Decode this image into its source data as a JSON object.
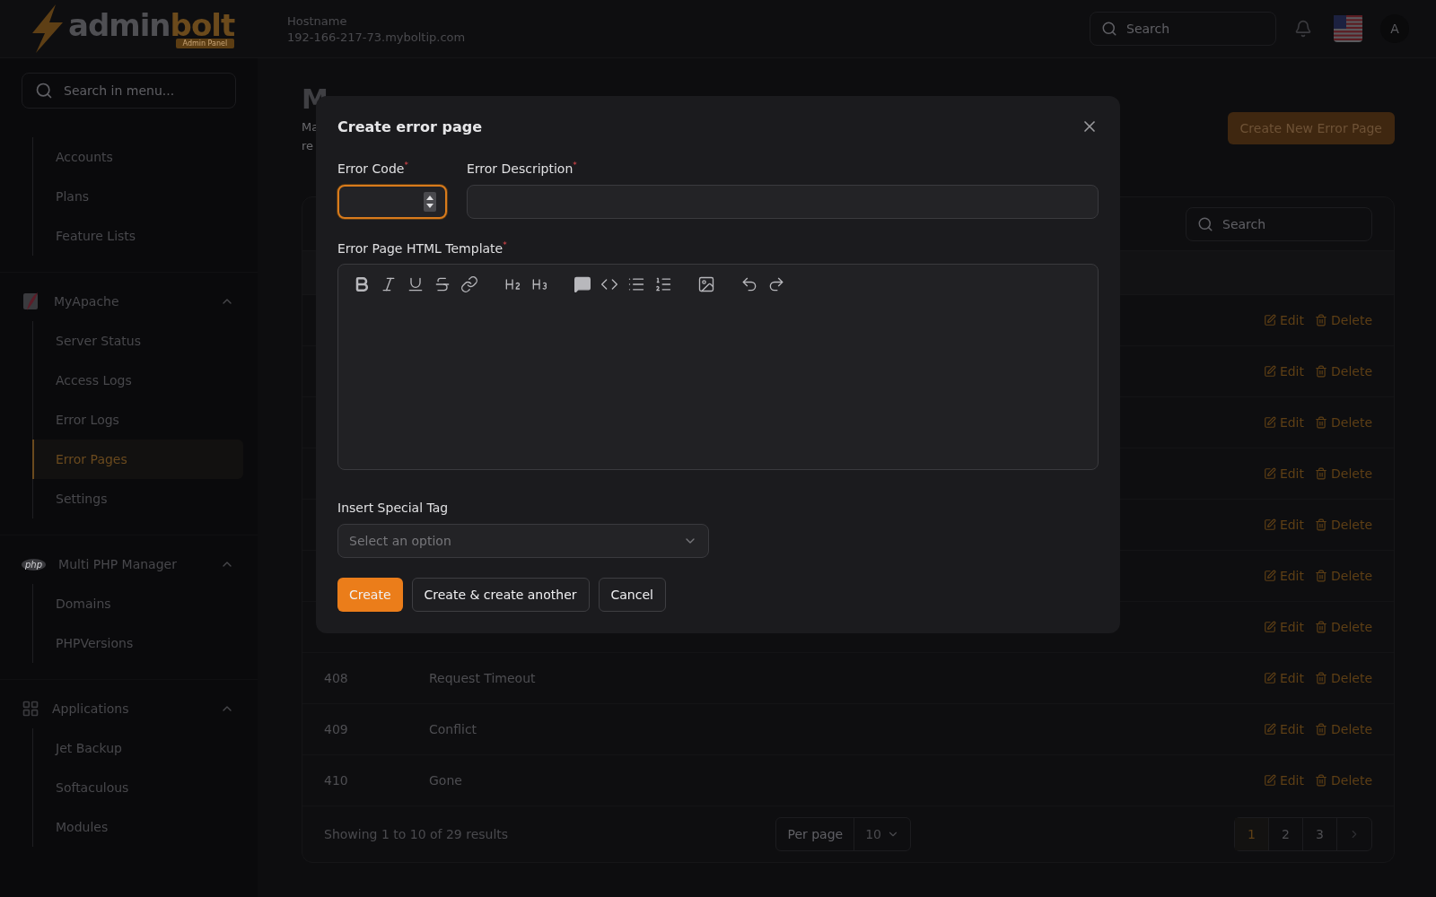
{
  "header": {
    "logo": {
      "word_1": "admin",
      "word_2": "bolt",
      "badge": "Admin Panel"
    },
    "hostname_label": "Hostname",
    "hostname": "192-166-217-73.myboltip.com",
    "search_placeholder": "Search",
    "avatar": "A"
  },
  "sidebar": {
    "search_placeholder": "Search in menu...",
    "groups": [
      {
        "items": [
          {
            "label": "Accounts",
            "selected": false
          },
          {
            "label": "Plans",
            "selected": false
          },
          {
            "label": "Feature Lists",
            "selected": false
          }
        ]
      },
      {
        "title": "MyApache",
        "kind": "apache",
        "expanded": true,
        "items": [
          {
            "label": "Server Status",
            "selected": false
          },
          {
            "label": "Access Logs",
            "selected": false
          },
          {
            "label": "Error Logs",
            "selected": false
          },
          {
            "label": "Error Pages",
            "selected": true
          },
          {
            "label": "Settings",
            "selected": false
          }
        ]
      },
      {
        "title": "Multi PHP Manager",
        "kind": "php",
        "icon_label": "php",
        "expanded": true,
        "items": [
          {
            "label": "Domains",
            "selected": false
          },
          {
            "label": "PHPVersions",
            "selected": false
          }
        ]
      },
      {
        "title": "Applications",
        "kind": "apps",
        "expanded": true,
        "items": [
          {
            "label": "Jet Backup",
            "selected": false
          },
          {
            "label": "Softaculous",
            "selected": false
          },
          {
            "label": "Modules",
            "selected": false
          }
        ]
      }
    ]
  },
  "page": {
    "title": "M",
    "description_lines": [
      "Ma",
      "re"
    ],
    "create_button": "Create New Error Page"
  },
  "table": {
    "search_placeholder": "Search",
    "rows": [
      {
        "edit": "Edit",
        "delete": "Delete"
      },
      {
        "edit": "Edit",
        "delete": "Delete"
      },
      {
        "edit": "Edit",
        "delete": "Delete"
      },
      {
        "edit": "Edit",
        "delete": "Delete"
      },
      {
        "edit": "Edit",
        "delete": "Delete"
      },
      {
        "edit": "Edit",
        "delete": "Delete"
      },
      {
        "edit": "Edit",
        "delete": "Delete"
      },
      {
        "code": "408",
        "description": "Request Timeout",
        "edit": "Edit",
        "delete": "Delete"
      },
      {
        "code": "409",
        "description": "Conflict",
        "edit": "Edit",
        "delete": "Delete"
      },
      {
        "code": "410",
        "description": "Gone",
        "edit": "Edit",
        "delete": "Delete"
      }
    ],
    "footer": {
      "summary": "Showing 1 to 10 of 29 results",
      "per_page_label": "Per page",
      "per_page_value": "10",
      "pages": [
        {
          "label": "1",
          "selected": true
        },
        {
          "label": "2",
          "selected": false
        },
        {
          "label": "3",
          "selected": false
        }
      ]
    }
  },
  "modal": {
    "title": "Create error page",
    "required_mark": "*",
    "error_code": {
      "label": "Error Code",
      "required": true,
      "focused": true
    },
    "error_description": {
      "label": "Error Description",
      "required": true,
      "focused": false
    },
    "template": {
      "label": "Error Page HTML Template",
      "required": true
    },
    "special_tag": {
      "label": "Insert Special Tag",
      "placeholder": "Select an option"
    },
    "buttons": [
      {
        "label": "Create",
        "kind": "primary"
      },
      {
        "label": "Create & create another",
        "kind": "secondary"
      },
      {
        "label": "Cancel",
        "kind": "secondary"
      }
    ]
  }
}
